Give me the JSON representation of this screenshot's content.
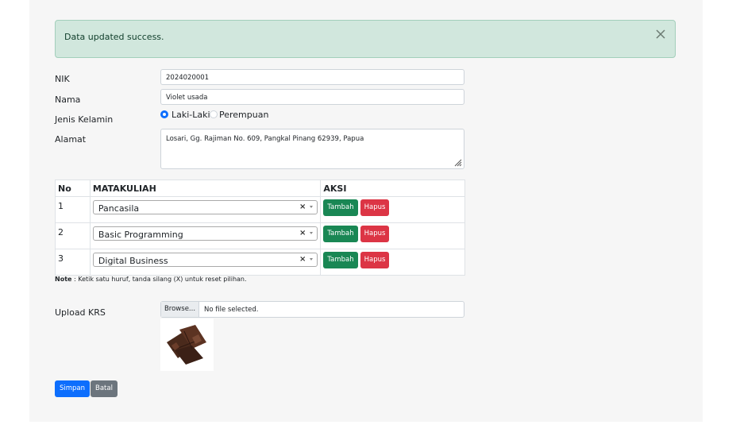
{
  "alert": {
    "message": "Data updated success.",
    "close_icon": "close-icon"
  },
  "form": {
    "nik": {
      "label": "NIK",
      "value": "2024020001"
    },
    "nama": {
      "label": "Nama",
      "value": "Violet usada"
    },
    "jenis_kelamin": {
      "label": "Jenis Kelamin",
      "options": [
        {
          "label": "Laki-Laki",
          "checked": true
        },
        {
          "label": "Perempuan",
          "checked": false
        }
      ]
    },
    "alamat": {
      "label": "Alamat",
      "value": "Losari, Gg. Rajiman No. 609, Pangkal Pinang 62939, Papua"
    }
  },
  "table": {
    "headers": [
      "No",
      "MATAKULIAH",
      "AKSI"
    ],
    "rows": [
      {
        "no": "1",
        "matakuliah": "Pancasila"
      },
      {
        "no": "2",
        "matakuliah": "Basic Programming"
      },
      {
        "no": "3",
        "matakuliah": "Digital Business"
      }
    ],
    "clear_symbol": "×",
    "add_label": "Tambah",
    "delete_label": "Hapus"
  },
  "note": {
    "bold": "Note",
    "text": " : Ketik satu huruf, tanda silang (X) untuk reset pilihan."
  },
  "upload": {
    "label": "Upload KRS",
    "browse_label": "Browse...",
    "file_status": "No file selected."
  },
  "buttons": {
    "save": "Simpan",
    "cancel": "Batal"
  },
  "colors": {
    "success_bg": "#d1e7dd",
    "primary": "#0d6efd",
    "green": "#198754",
    "red": "#dc3545",
    "gray": "#6c757d"
  }
}
